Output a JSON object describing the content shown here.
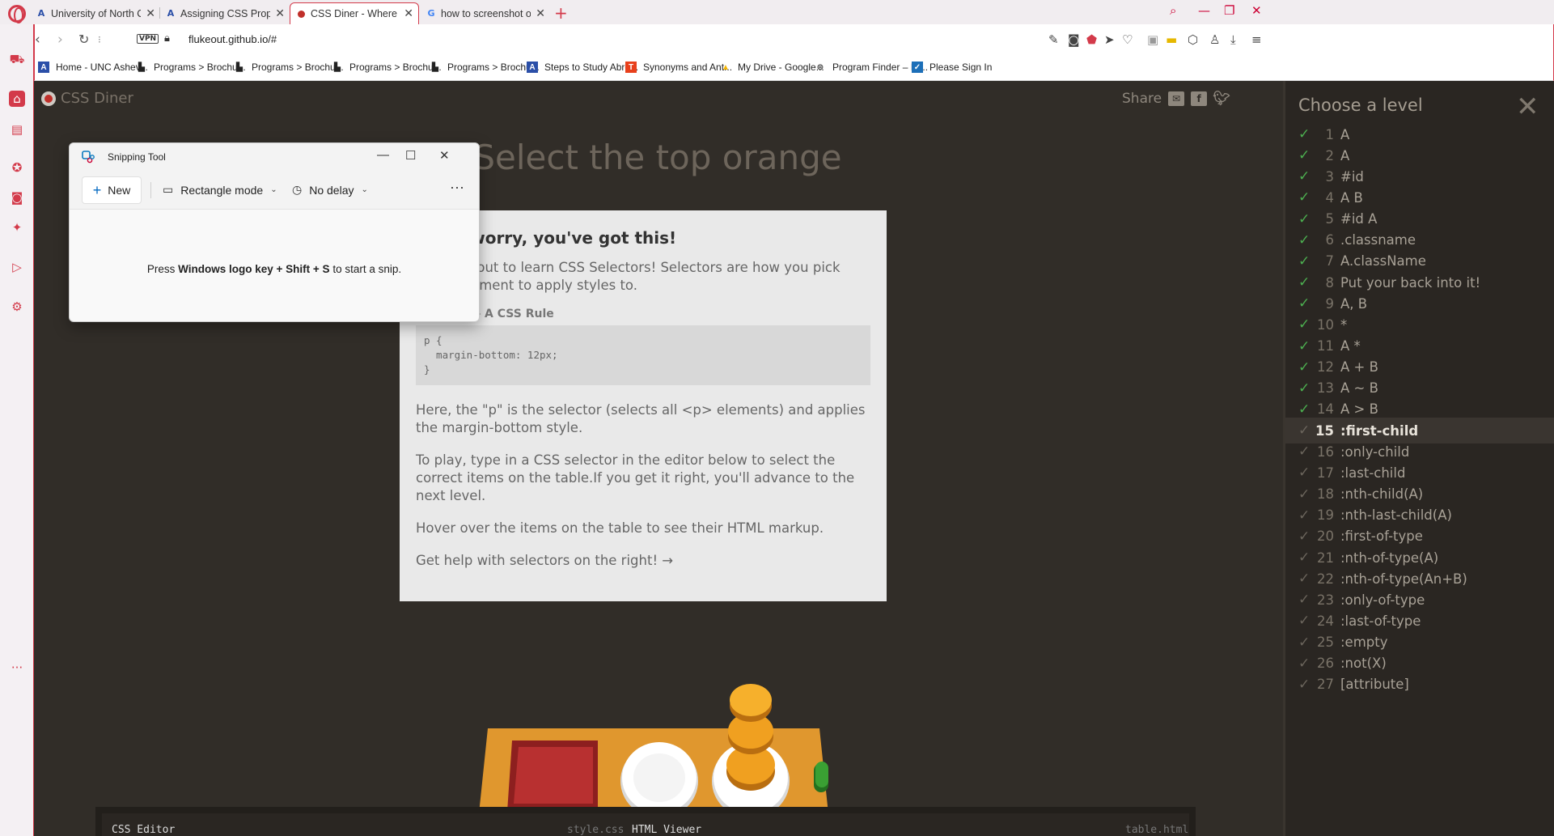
{
  "browser": {
    "tabs": [
      {
        "title": "University of North Carolina",
        "icon": "canvas-icon",
        "color": "#2b4fa8"
      },
      {
        "title": "Assigning CSS Properties U",
        "icon": "canvas-icon",
        "color": "#2b4fa8"
      },
      {
        "title": "CSS Diner - Where we feast",
        "icon": "diner-icon",
        "color": "#c0302a"
      },
      {
        "title": "how to screenshot on wind",
        "icon": "google-icon",
        "color": "#4285f4"
      }
    ],
    "url": "flukeout.github.io/#",
    "vpn_label": "VPN",
    "bookmarks": [
      {
        "label": "Home - UNC Ashev...",
        "icon": "canvas-icon"
      },
      {
        "label": "Programs > Brochu...",
        "icon": "page-icon"
      },
      {
        "label": "Programs > Brochu...",
        "icon": "page-icon"
      },
      {
        "label": "Programs > Brochu...",
        "icon": "page-icon"
      },
      {
        "label": "Programs > Brochu...",
        "icon": "page-icon"
      },
      {
        "label": "Steps to Study Abro...",
        "icon": "canvas-icon"
      },
      {
        "label": "Synonyms and Ant...",
        "icon": "thesaurus-icon"
      },
      {
        "label": "My Drive - Google...",
        "icon": "drive-icon"
      },
      {
        "label": "Program Finder – IS...",
        "icon": "globe-icon"
      },
      {
        "label": "Please Sign In",
        "icon": "signin-icon"
      }
    ],
    "accent": "#d33a4a"
  },
  "app": {
    "logo_text": "CSS Diner",
    "share_label": "Share",
    "level_title": "Select the top orange",
    "help": {
      "heading": "Don't worry, you've got this!",
      "intro": "You're about to learn CSS Selectors! Selectors are how you pick which element to apply styles to.",
      "exhibit_label": "Exhibit 1 - A CSS Rule",
      "code_line1": "p {",
      "code_line2": "  margin-bottom: 12px;",
      "code_line3": "}",
      "para1": "Here, the \"p\" is the selector (selects all <p> elements) and applies the margin-bottom style.",
      "para2": "To play, type in a CSS selector in the editor below to select the correct items on the table.If you get it right, you'll advance to the next level.",
      "para3": "Hover over the items on the table to see their HTML markup.",
      "para4": "Get help with selectors on the right! →"
    },
    "editor": {
      "css_label": "CSS Editor",
      "css_file": "style.css",
      "html_label": "HTML Viewer",
      "html_file": "table.html"
    },
    "levels_title": "Choose a level",
    "current_level": 15,
    "levels": [
      {
        "num": "1",
        "name": "A",
        "done": true
      },
      {
        "num": "2",
        "name": "A",
        "done": true
      },
      {
        "num": "3",
        "name": "#id",
        "done": true
      },
      {
        "num": "4",
        "name": "A  B",
        "done": true
      },
      {
        "num": "5",
        "name": "#id  A",
        "done": true
      },
      {
        "num": "6",
        "name": ".classname",
        "done": true
      },
      {
        "num": "7",
        "name": "A.className",
        "done": true
      },
      {
        "num": "8",
        "name": "Put your back into it!",
        "done": true
      },
      {
        "num": "9",
        "name": "A, B",
        "done": true
      },
      {
        "num": "10",
        "name": "*",
        "done": true
      },
      {
        "num": "11",
        "name": "A  *",
        "done": true
      },
      {
        "num": "12",
        "name": "A + B",
        "done": true
      },
      {
        "num": "13",
        "name": "A ~ B",
        "done": true
      },
      {
        "num": "14",
        "name": "A > B",
        "done": true
      },
      {
        "num": "15",
        "name": ":first-child",
        "done": false
      },
      {
        "num": "16",
        "name": ":only-child",
        "done": false
      },
      {
        "num": "17",
        "name": ":last-child",
        "done": false
      },
      {
        "num": "18",
        "name": ":nth-child(A)",
        "done": false
      },
      {
        "num": "19",
        "name": ":nth-last-child(A)",
        "done": false
      },
      {
        "num": "20",
        "name": ":first-of-type",
        "done": false
      },
      {
        "num": "21",
        "name": ":nth-of-type(A)",
        "done": false
      },
      {
        "num": "22",
        "name": ":nth-of-type(An+B)",
        "done": false
      },
      {
        "num": "23",
        "name": ":only-of-type",
        "done": false
      },
      {
        "num": "24",
        "name": ":last-of-type",
        "done": false
      },
      {
        "num": "25",
        "name": ":empty",
        "done": false
      },
      {
        "num": "26",
        "name": ":not(X)",
        "done": false
      },
      {
        "num": "27",
        "name": "[attribute]",
        "done": false
      }
    ],
    "colors": {
      "done_check": "#4caf50",
      "orange": "#f0a020",
      "pickle": "#3aa033",
      "bento": "#b83030"
    }
  },
  "snipping_tool": {
    "title": "Snipping Tool",
    "new_label": "New",
    "mode_label": "Rectangle mode",
    "delay_label": "No delay",
    "msg_prefix": "Press ",
    "msg_keys": "Windows logo key + Shift + S",
    "msg_suffix": " to start a snip."
  }
}
